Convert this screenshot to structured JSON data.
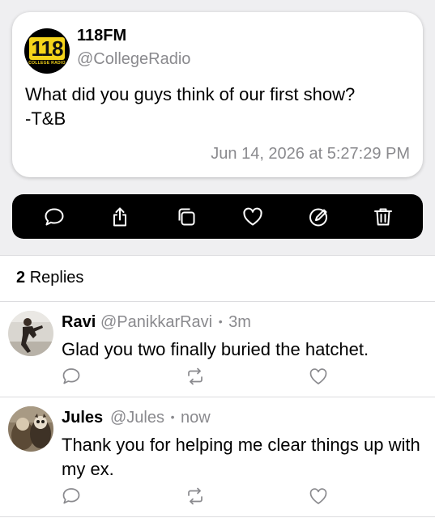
{
  "post": {
    "display_name": "118FM",
    "handle": "@CollegeRadio",
    "text": "What did you guys think of our first show?\n-T&B",
    "timestamp": "Jun 14, 2026 at 5:27:29 PM",
    "logo_text": "118",
    "logo_subtext": "COLLEGE RADIO",
    "logo_colors": {
      "background": "#000000",
      "plate": "#f5d41a"
    }
  },
  "actions": [
    {
      "icon": "reply-icon"
    },
    {
      "icon": "share-icon"
    },
    {
      "icon": "copy-icon"
    },
    {
      "icon": "heart-icon"
    },
    {
      "icon": "edit-icon"
    },
    {
      "icon": "trash-icon"
    }
  ],
  "replies_header": {
    "count": "2",
    "label": "Replies"
  },
  "replies": [
    {
      "name": "Ravi",
      "handle": "@PanikkarRavi",
      "separator": "•",
      "time": "3m",
      "text": "Glad you two finally buried the hatchet."
    },
    {
      "name": "Jules",
      "handle": "@Jules",
      "separator": "•",
      "time": "now",
      "text": "Thank you for helping me clear things up with my ex."
    }
  ],
  "colors": {
    "accent_bar": "#000000",
    "muted_text": "#8a8a8e",
    "page_background": "#efeff1"
  }
}
